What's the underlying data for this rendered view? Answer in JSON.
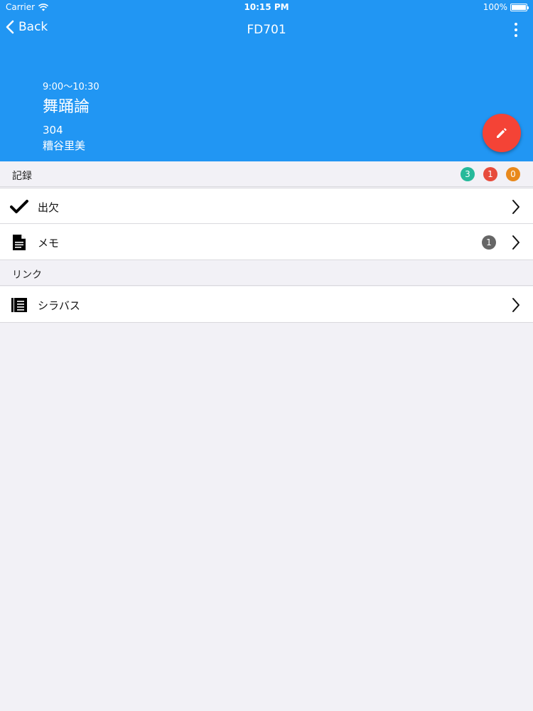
{
  "status_bar": {
    "carrier": "Carrier",
    "time": "10:15 PM",
    "battery": "100%"
  },
  "nav": {
    "back_label": "Back",
    "title": "FD701"
  },
  "class_info": {
    "time_range": "9:00〜10:30",
    "course_name": "舞踊論",
    "room": "304",
    "teacher": "糟谷里美"
  },
  "records": {
    "header": "記録",
    "badges": [
      {
        "value": "3",
        "color": "#26b99a"
      },
      {
        "value": "1",
        "color": "#e74c3c"
      },
      {
        "value": "0",
        "color": "#e8891c"
      }
    ],
    "items": [
      {
        "label": "出欠",
        "icon": "checkmark-icon"
      },
      {
        "label": "メモ",
        "icon": "document-icon",
        "count": "1"
      }
    ]
  },
  "links": {
    "header": "リンク",
    "items": [
      {
        "label": "シラバス",
        "icon": "notebook-icon"
      }
    ]
  },
  "colors": {
    "primary": "#2196f3",
    "fab": "#f44336",
    "background": "#f2f1f6"
  }
}
